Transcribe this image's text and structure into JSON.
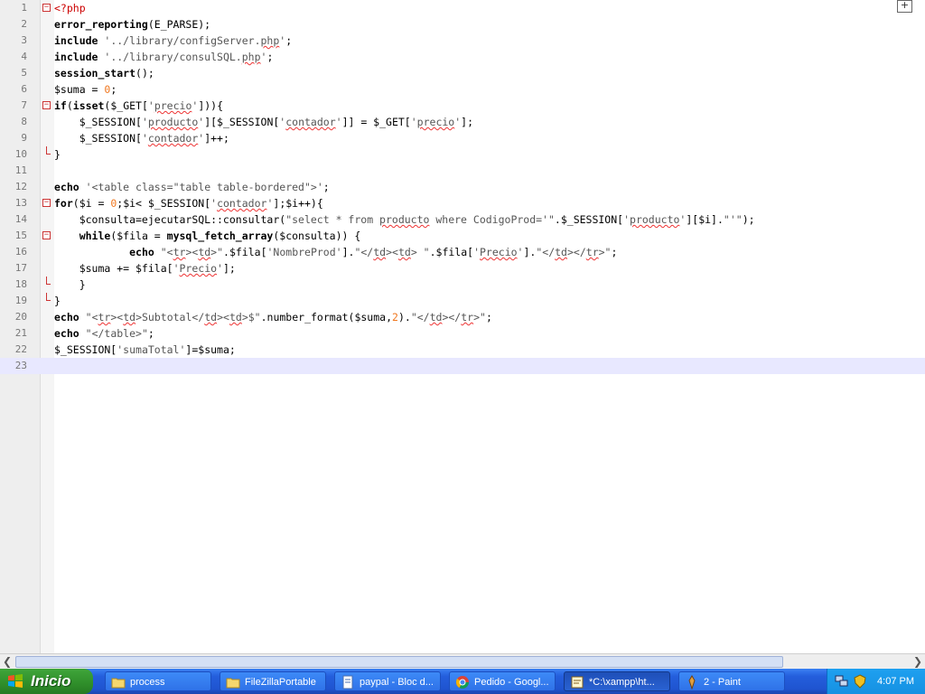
{
  "editor": {
    "lines": [
      {
        "n": "1",
        "tokens": [
          {
            "c": "php",
            "t": "<?php"
          }
        ]
      },
      {
        "n": "2",
        "tokens": [
          {
            "c": "kw",
            "t": "error_reporting"
          },
          {
            "c": "",
            "t": "(E_PARSE)"
          },
          {
            "c": "",
            "t": ";"
          }
        ]
      },
      {
        "n": "3",
        "tokens": [
          {
            "c": "kw",
            "t": "include"
          },
          {
            "c": "",
            "t": " "
          },
          {
            "c": "str",
            "t": "'../library/configServer."
          },
          {
            "c": "str sq",
            "t": "php"
          },
          {
            "c": "str",
            "t": "'"
          },
          {
            "c": "",
            "t": ";"
          }
        ]
      },
      {
        "n": "4",
        "tokens": [
          {
            "c": "kw",
            "t": "include"
          },
          {
            "c": "",
            "t": " "
          },
          {
            "c": "str",
            "t": "'../library/consulSQL."
          },
          {
            "c": "str sq",
            "t": "php"
          },
          {
            "c": "str",
            "t": "'"
          },
          {
            "c": "",
            "t": ";"
          }
        ]
      },
      {
        "n": "5",
        "tokens": [
          {
            "c": "kw",
            "t": "session_start"
          },
          {
            "c": "",
            "t": "();"
          }
        ]
      },
      {
        "n": "6",
        "tokens": [
          {
            "c": "var",
            "t": "$suma"
          },
          {
            "c": "",
            "t": " = "
          },
          {
            "c": "num",
            "t": "0"
          },
          {
            "c": "",
            "t": ";"
          }
        ]
      },
      {
        "n": "7",
        "tokens": [
          {
            "c": "kw",
            "t": "if"
          },
          {
            "c": "",
            "t": "("
          },
          {
            "c": "kw",
            "t": "isset"
          },
          {
            "c": "",
            "t": "($_GET["
          },
          {
            "c": "str",
            "t": "'"
          },
          {
            "c": "str sq",
            "t": "precio"
          },
          {
            "c": "str",
            "t": "'"
          },
          {
            "c": "",
            "t": "])){"
          }
        ]
      },
      {
        "n": "8",
        "tokens": [
          {
            "c": "",
            "t": "    $_SESSION["
          },
          {
            "c": "str",
            "t": "'"
          },
          {
            "c": "str sq",
            "t": "producto"
          },
          {
            "c": "str",
            "t": "'"
          },
          {
            "c": "",
            "t": "][$_SESSION["
          },
          {
            "c": "str",
            "t": "'"
          },
          {
            "c": "str sq",
            "t": "contador"
          },
          {
            "c": "str",
            "t": "'"
          },
          {
            "c": "",
            "t": "]] = $_GET["
          },
          {
            "c": "str",
            "t": "'"
          },
          {
            "c": "str sq",
            "t": "precio"
          },
          {
            "c": "str",
            "t": "'"
          },
          {
            "c": "",
            "t": "];"
          }
        ]
      },
      {
        "n": "9",
        "tokens": [
          {
            "c": "",
            "t": "    $_SESSION["
          },
          {
            "c": "str",
            "t": "'"
          },
          {
            "c": "str sq",
            "t": "contador"
          },
          {
            "c": "str",
            "t": "'"
          },
          {
            "c": "",
            "t": "]++;"
          }
        ]
      },
      {
        "n": "10",
        "tokens": [
          {
            "c": "",
            "t": "}"
          }
        ]
      },
      {
        "n": "11",
        "tokens": []
      },
      {
        "n": "12",
        "tokens": [
          {
            "c": "kw",
            "t": "echo"
          },
          {
            "c": "",
            "t": " "
          },
          {
            "c": "str",
            "t": "'<table class=\"table table-bordered\">'"
          },
          {
            "c": "",
            "t": ";"
          }
        ]
      },
      {
        "n": "13",
        "tokens": [
          {
            "c": "kw",
            "t": "for"
          },
          {
            "c": "",
            "t": "($i = "
          },
          {
            "c": "num",
            "t": "0"
          },
          {
            "c": "",
            "t": ";$i< $_SESSION["
          },
          {
            "c": "str",
            "t": "'"
          },
          {
            "c": "str sq",
            "t": "contador"
          },
          {
            "c": "str",
            "t": "'"
          },
          {
            "c": "",
            "t": "];$i++){"
          }
        ]
      },
      {
        "n": "14",
        "tokens": [
          {
            "c": "",
            "t": "    $consulta=ejecutarSQL::consultar("
          },
          {
            "c": "str",
            "t": "\"select * from "
          },
          {
            "c": "str sq",
            "t": "producto"
          },
          {
            "c": "str",
            "t": " where CodigoProd='\""
          },
          {
            "c": "",
            "t": ".$_SESSION["
          },
          {
            "c": "str",
            "t": "'"
          },
          {
            "c": "str sq",
            "t": "producto"
          },
          {
            "c": "str",
            "t": "'"
          },
          {
            "c": "",
            "t": "][$i]."
          },
          {
            "c": "str",
            "t": "\"'\""
          },
          {
            "c": "",
            "t": ");"
          }
        ]
      },
      {
        "n": "15",
        "tokens": [
          {
            "c": "",
            "t": "    "
          },
          {
            "c": "kw",
            "t": "while"
          },
          {
            "c": "",
            "t": "($fila = "
          },
          {
            "c": "kw",
            "t": "mysql_fetch_array"
          },
          {
            "c": "",
            "t": "($consulta)) {"
          }
        ]
      },
      {
        "n": "16",
        "tokens": [
          {
            "c": "",
            "t": "            "
          },
          {
            "c": "kw",
            "t": "echo"
          },
          {
            "c": "",
            "t": " "
          },
          {
            "c": "str",
            "t": "\"<"
          },
          {
            "c": "str sq",
            "t": "tr"
          },
          {
            "c": "str",
            "t": "><"
          },
          {
            "c": "str sq",
            "t": "td"
          },
          {
            "c": "str",
            "t": ">\""
          },
          {
            "c": "",
            "t": ".$fila["
          },
          {
            "c": "str",
            "t": "'NombreProd'"
          },
          {
            "c": "",
            "t": "]."
          },
          {
            "c": "str",
            "t": "\"</"
          },
          {
            "c": "str sq",
            "t": "td"
          },
          {
            "c": "str",
            "t": "><"
          },
          {
            "c": "str sq",
            "t": "td"
          },
          {
            "c": "str",
            "t": "> \""
          },
          {
            "c": "",
            "t": ".$fila["
          },
          {
            "c": "str",
            "t": "'"
          },
          {
            "c": "str sq",
            "t": "Precio"
          },
          {
            "c": "str",
            "t": "'"
          },
          {
            "c": "",
            "t": "]."
          },
          {
            "c": "str",
            "t": "\"</"
          },
          {
            "c": "str sq",
            "t": "td"
          },
          {
            "c": "str",
            "t": "></"
          },
          {
            "c": "str sq",
            "t": "tr"
          },
          {
            "c": "str",
            "t": ">\""
          },
          {
            "c": "",
            "t": ";"
          }
        ]
      },
      {
        "n": "17",
        "tokens": [
          {
            "c": "",
            "t": "    $suma += $fila["
          },
          {
            "c": "str",
            "t": "'"
          },
          {
            "c": "str sq",
            "t": "Precio"
          },
          {
            "c": "str",
            "t": "'"
          },
          {
            "c": "",
            "t": "];"
          }
        ]
      },
      {
        "n": "18",
        "tokens": [
          {
            "c": "",
            "t": "    }"
          }
        ]
      },
      {
        "n": "19",
        "tokens": [
          {
            "c": "",
            "t": "}"
          }
        ]
      },
      {
        "n": "20",
        "tokens": [
          {
            "c": "kw",
            "t": "echo"
          },
          {
            "c": "",
            "t": " "
          },
          {
            "c": "str",
            "t": "\"<"
          },
          {
            "c": "str sq",
            "t": "tr"
          },
          {
            "c": "str",
            "t": "><"
          },
          {
            "c": "str sq",
            "t": "td"
          },
          {
            "c": "str",
            "t": ">Subtotal</"
          },
          {
            "c": "str sq",
            "t": "td"
          },
          {
            "c": "str",
            "t": "><"
          },
          {
            "c": "str sq",
            "t": "td"
          },
          {
            "c": "str",
            "t": ">$\""
          },
          {
            "c": "",
            "t": ".number_format($suma,"
          },
          {
            "c": "num",
            "t": "2"
          },
          {
            "c": "",
            "t": ")."
          },
          {
            "c": "str",
            "t": "\"</"
          },
          {
            "c": "str sq",
            "t": "td"
          },
          {
            "c": "str",
            "t": "></"
          },
          {
            "c": "str sq",
            "t": "tr"
          },
          {
            "c": "str",
            "t": ">\""
          },
          {
            "c": "",
            "t": ";"
          }
        ]
      },
      {
        "n": "21",
        "tokens": [
          {
            "c": "kw",
            "t": "echo"
          },
          {
            "c": "",
            "t": " "
          },
          {
            "c": "str",
            "t": "\"</table>\""
          },
          {
            "c": "",
            "t": ";"
          }
        ]
      },
      {
        "n": "22",
        "tokens": [
          {
            "c": "",
            "t": "$_SESSION["
          },
          {
            "c": "str",
            "t": "'sumaTotal'"
          },
          {
            "c": "",
            "t": "]=$suma;"
          }
        ]
      },
      {
        "n": "23",
        "tokens": [],
        "current": true
      }
    ],
    "fold_markers": {
      "1": "box",
      "7": "box",
      "10": "end",
      "13": "box",
      "15": "box",
      "18": "end",
      "19": "end"
    },
    "corner_button": "+"
  },
  "taskbar": {
    "start_label": "Inicio",
    "tasks": [
      {
        "label": "process",
        "icon": "folder-icon",
        "active": false
      },
      {
        "label": "FileZillaPortable",
        "icon": "folder-icon",
        "active": false
      },
      {
        "label": "paypal - Bloc d...",
        "icon": "notepad-icon",
        "active": false
      },
      {
        "label": "Pedido - Googl...",
        "icon": "chrome-icon",
        "active": false
      },
      {
        "label": "*C:\\xampp\\ht...",
        "icon": "editor-icon",
        "active": true
      },
      {
        "label": "2 - Paint",
        "icon": "paint-icon",
        "active": false
      }
    ],
    "clock": "4:07 PM",
    "colors": {
      "bar": "#245edc",
      "start": "#2f8e2a",
      "tray": "#1691e2"
    }
  },
  "colors": {
    "keyword": "#000000",
    "string": "#555555",
    "number": "#f07820",
    "php_tag": "#cc0000",
    "current_line": "#e8e8ff"
  }
}
